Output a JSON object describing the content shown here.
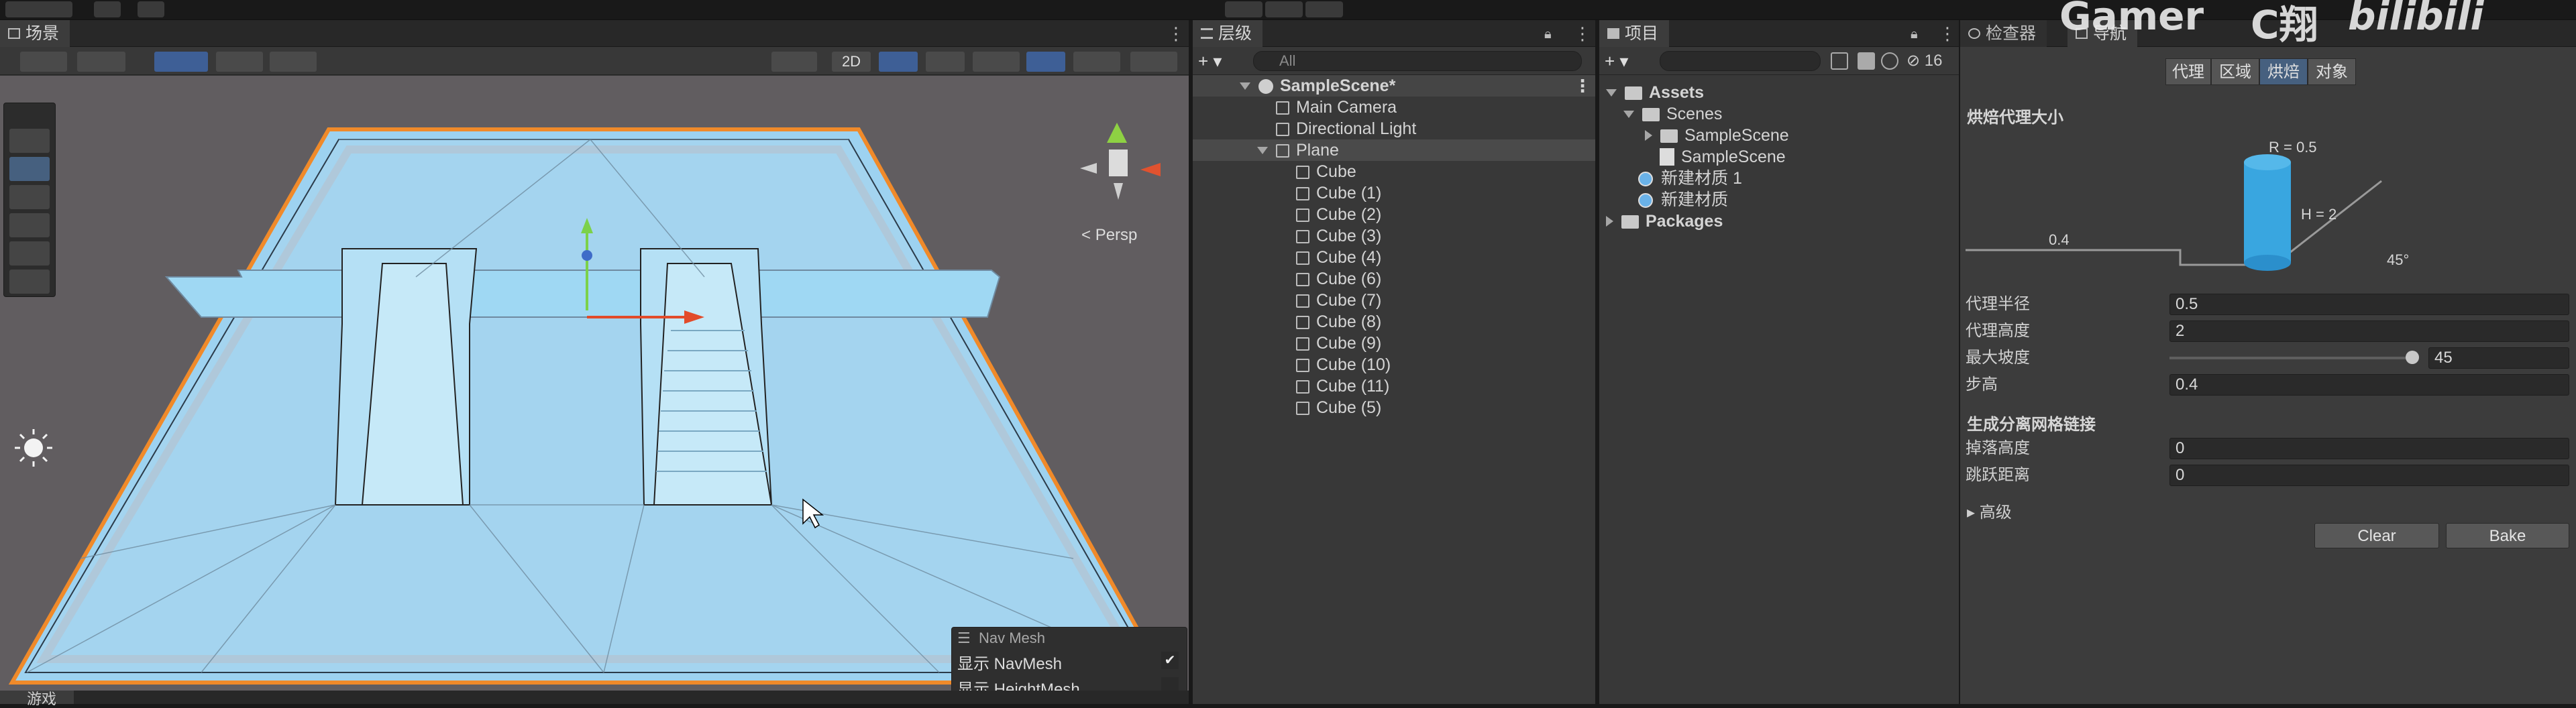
{
  "scene": {
    "tab_label": "场景",
    "view_label": "Persp",
    "btn_2d": "2D",
    "navmesh_overlay": {
      "title": "Nav Mesh",
      "show_navmesh": "显示 NavMesh",
      "show_navmesh_checked": true,
      "show_heightmesh": "显示 HeightMesh",
      "show_heightmesh_checked": false
    }
  },
  "game": {
    "tab_label": "游戏"
  },
  "hierarchy": {
    "tab_label": "层级",
    "search_placeholder": "All",
    "scene_name": "SampleScene*",
    "items": [
      {
        "label": "Main Camera"
      },
      {
        "label": "Directional Light"
      },
      {
        "label": "Plane"
      },
      {
        "label": "Cube"
      },
      {
        "label": "Cube (1)"
      },
      {
        "label": "Cube (2)"
      },
      {
        "label": "Cube (3)"
      },
      {
        "label": "Cube (4)"
      },
      {
        "label": "Cube (6)"
      },
      {
        "label": "Cube (7)"
      },
      {
        "label": "Cube (8)"
      },
      {
        "label": "Cube (9)"
      },
      {
        "label": "Cube (10)"
      },
      {
        "label": "Cube (11)"
      },
      {
        "label": "Cube (5)"
      }
    ]
  },
  "project": {
    "tab_label": "项目",
    "hidden_count": "16",
    "tree": [
      {
        "label": "Assets"
      },
      {
        "label": "Scenes"
      },
      {
        "label": "SampleScene"
      },
      {
        "label": "SampleScene"
      },
      {
        "label": "新建材质 1"
      },
      {
        "label": "新建材质"
      },
      {
        "label": "Packages"
      }
    ]
  },
  "inspector": {
    "tab_label": "检查器"
  },
  "navigation": {
    "tab_label": "导航",
    "subtabs": [
      "代理",
      "区域",
      "烘焙",
      "对象"
    ],
    "active_subtab": "烘焙",
    "section_agent_size": "烘焙代理大小",
    "diagram": {
      "r_label": "R = 0.5",
      "h_label": "H = 2",
      "step_label": "0.4",
      "slope_label": "45°"
    },
    "fields": {
      "agent_radius_label": "代理半径",
      "agent_radius": "0.5",
      "agent_height_label": "代理高度",
      "agent_height": "2",
      "max_slope_label": "最大坡度",
      "max_slope": "45",
      "step_height_label": "步高",
      "step_height": "0.4"
    },
    "offmesh_section": "生成分离网格链接",
    "drop_height_label": "掉落高度",
    "drop_height": "0",
    "jump_distance_label": "跳跃距离",
    "jump_distance": "0",
    "advanced_label": "高级",
    "clear_label": "Clear",
    "bake_label": "Bake"
  },
  "watermark": {
    "gamer": "Gamer",
    "handle": "C翔",
    "bili": "bilibili"
  },
  "colors": {
    "accent": "#46607f",
    "navmesh_blue": "#9dd2f0",
    "selection_orange": "#f08a2a",
    "scene_bg": "#5f5b5d"
  }
}
